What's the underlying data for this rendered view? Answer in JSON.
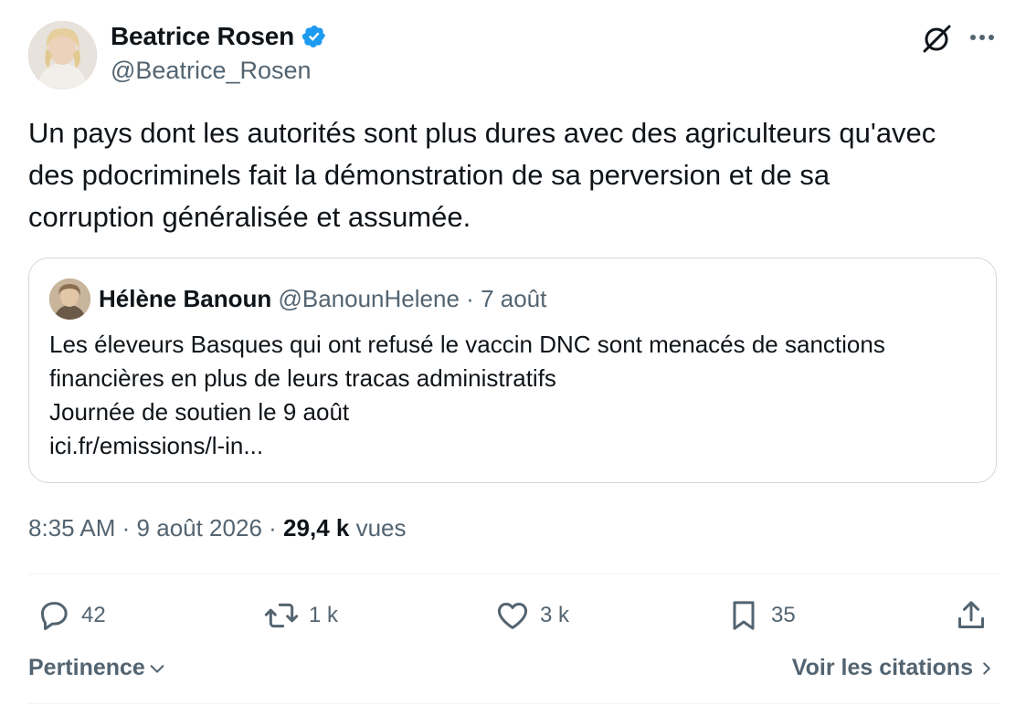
{
  "author": {
    "name": "Beatrice Rosen",
    "handle": "@Beatrice_Rosen",
    "verified": true
  },
  "header_actions": {
    "grok_icon": "grok-slashed-circle-icon",
    "more_icon": "more-dots-icon"
  },
  "tweet": {
    "lines": [
      "Un pays dont les autorités sont plus dures avec des agriculteurs qu'avec",
      "des pdocriminels fait la démonstration de sa perversion et de sa",
      "corruption généralisée et assumée."
    ]
  },
  "quote": {
    "name": "Hélène Banoun",
    "handle": "@BanounHelene",
    "separator": "·",
    "date": "7 août",
    "lines": [
      "Les éleveurs Basques qui ont refusé le vaccin DNC sont menacés de sanctions",
      "financières en plus de leurs tracas administratifs",
      "Journée de soutien le 9 août",
      "ici.fr/emissions/l-in..."
    ]
  },
  "meta": {
    "time": "8:35 AM",
    "separator": "·",
    "date": "9 août 2026",
    "views_count": "29,4 k",
    "views_label": "vues"
  },
  "actions": {
    "replies": "42",
    "retweets": "1 k",
    "likes": "3 k",
    "bookmarks": "35"
  },
  "footer": {
    "sort_label": "Pertinence",
    "quotes_link": "Voir les citations"
  },
  "colors": {
    "text": "#0f1419",
    "secondary": "#536471",
    "verified": "#1d9bf0",
    "border": "#cfd9de"
  }
}
